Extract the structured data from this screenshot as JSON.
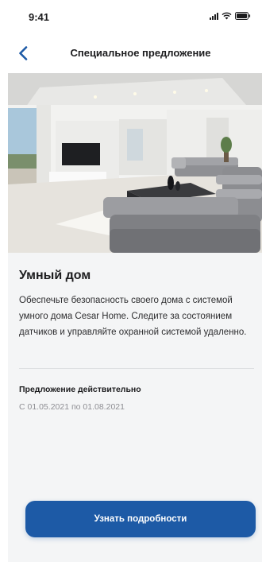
{
  "status_bar": {
    "time": "9:41"
  },
  "header": {
    "title": "Специальное предложение",
    "back_icon": "chevron-left-icon"
  },
  "offer": {
    "image_alt": "living-room-photo",
    "title": "Умный дом",
    "description": "Обеспечьте безопасность своего дома с системой умного дома Cesar Home. Следите за состоянием датчиков и управляйте охранной системой удаленно.",
    "validity_label": "Предложение действительно",
    "validity_dates": "С 01.05.2021 по 01.08.2021"
  },
  "cta": {
    "label": "Узнать подробности"
  },
  "colors": {
    "accent": "#1d5aa6",
    "card_background": "#f4f5f6",
    "secondary_text": "#8e8e93"
  }
}
